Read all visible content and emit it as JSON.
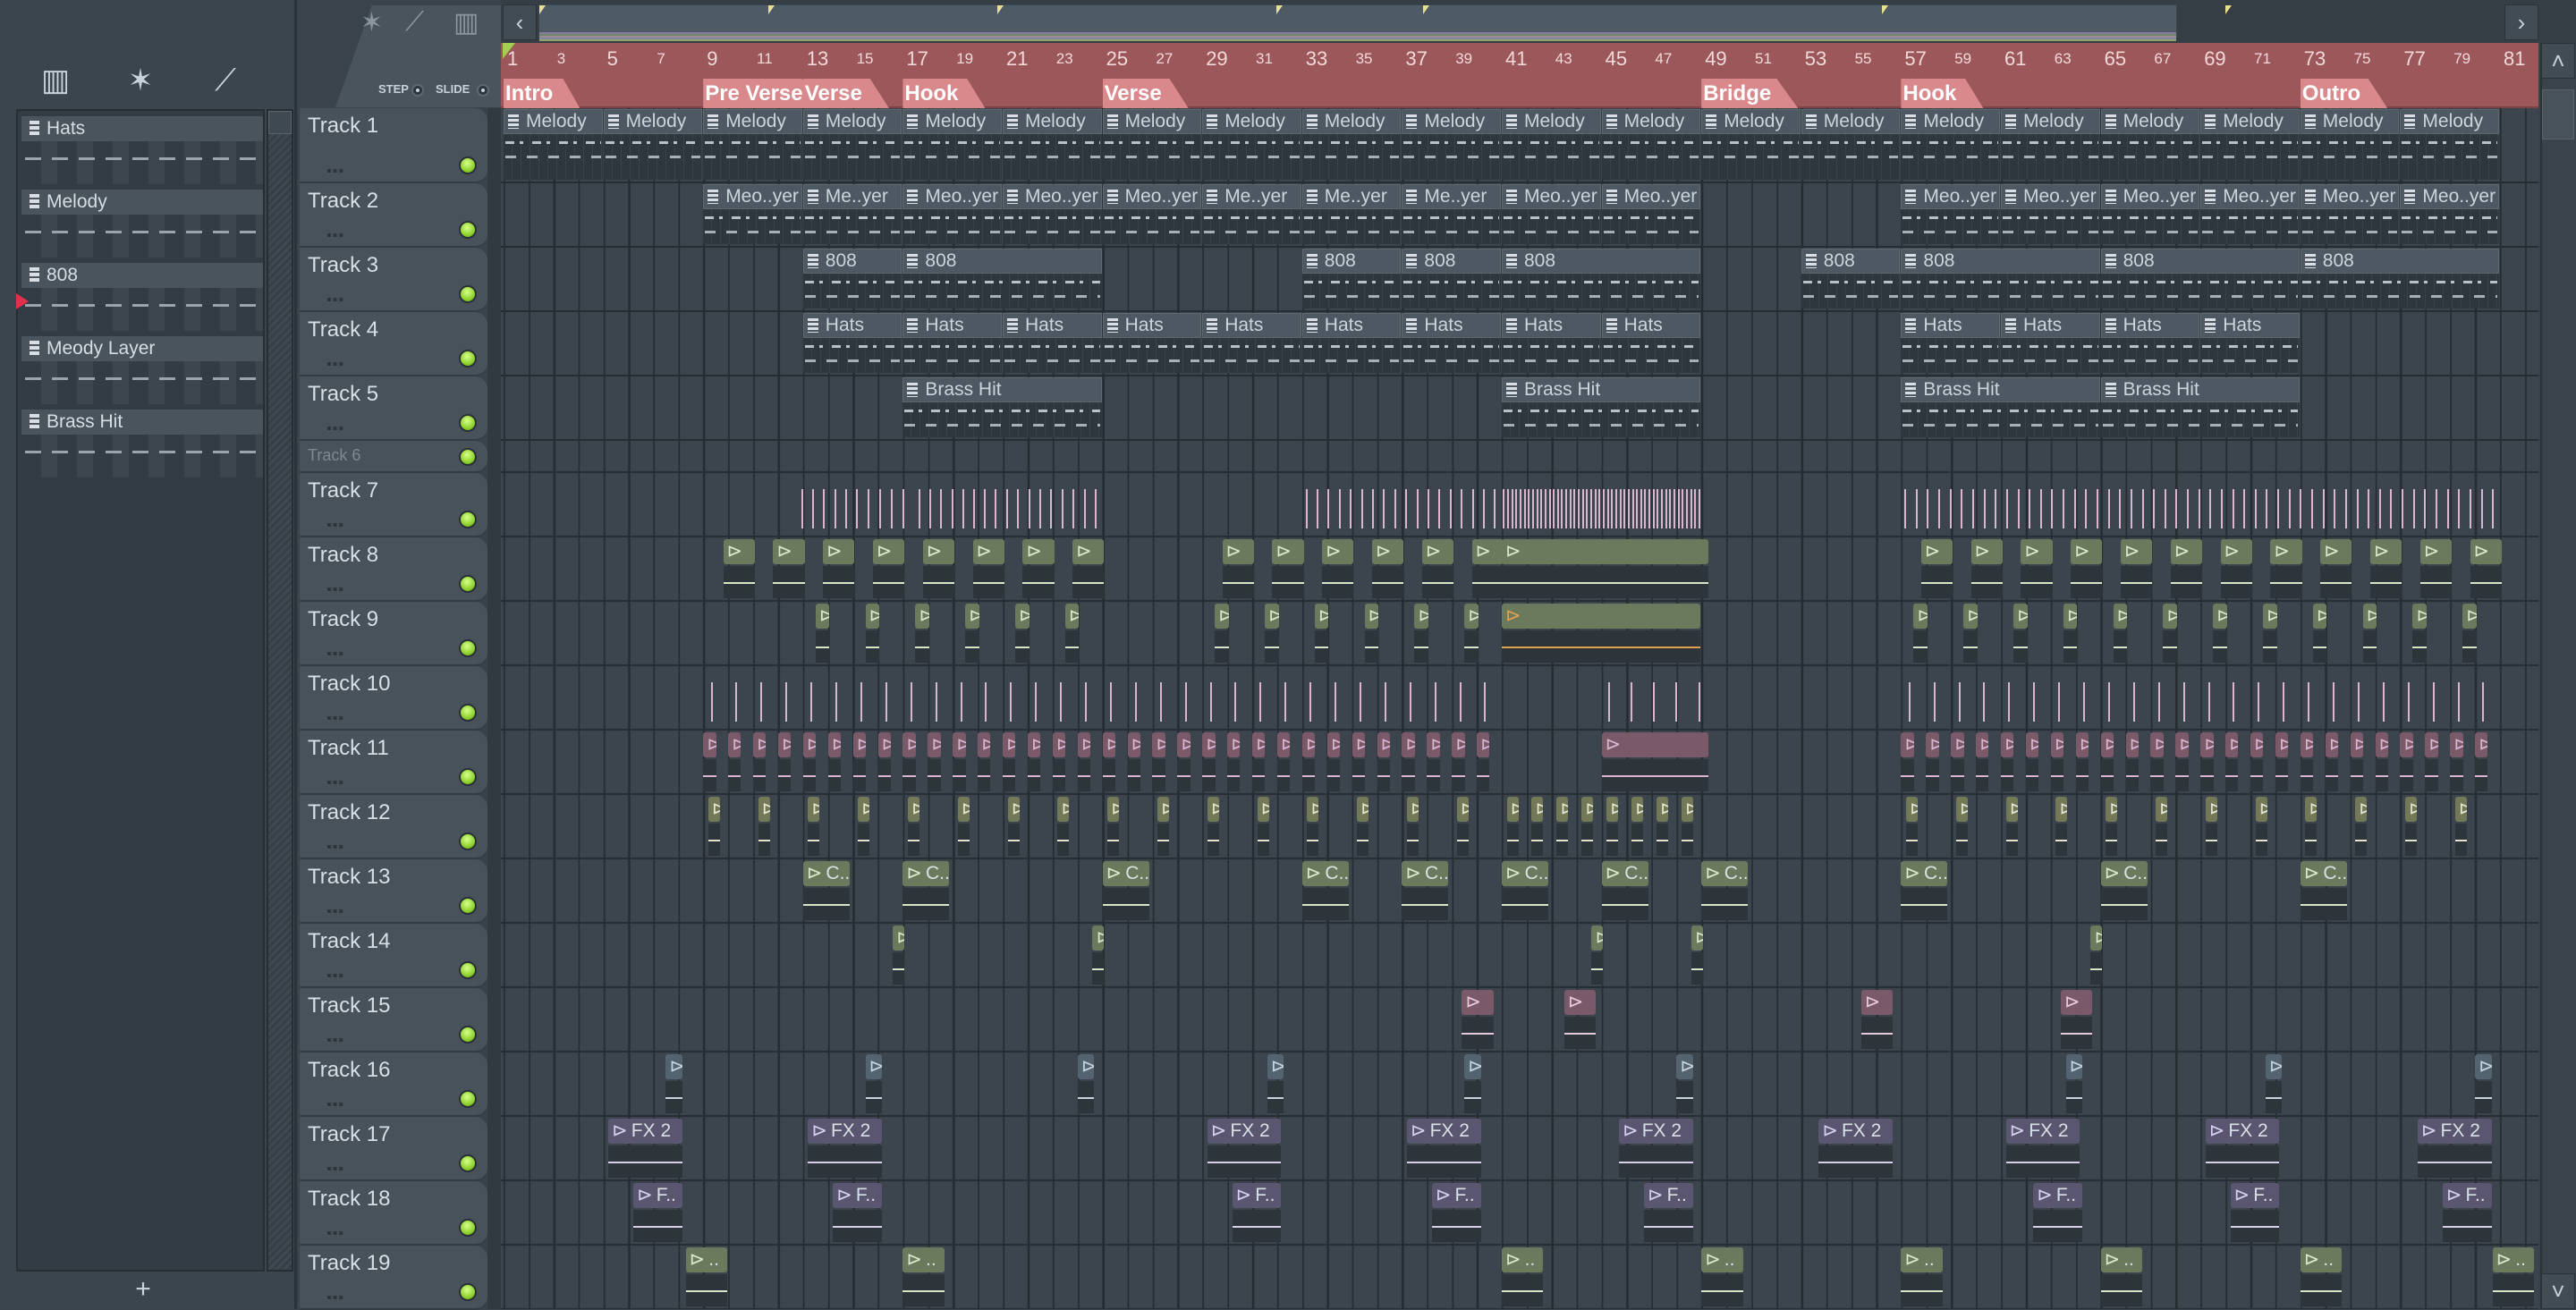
{
  "browser": {
    "tools": [
      {
        "icon": "piano-roll-icon",
        "glyph": "▥"
      },
      {
        "icon": "waveform-icon",
        "glyph": "✶"
      },
      {
        "icon": "automation-icon",
        "glyph": "⟋"
      }
    ],
    "patterns": [
      {
        "name": "Hats",
        "selected": false
      },
      {
        "name": "Melody",
        "selected": false
      },
      {
        "name": "808",
        "selected": true
      },
      {
        "name": "Meody Layer",
        "selected": false
      },
      {
        "name": "Brass Hit",
        "selected": false
      }
    ],
    "add_label": "+"
  },
  "header": {
    "step_label": "STEP",
    "slide_label": "SLIDE",
    "icons": [
      {
        "icon": "waveform-icon",
        "glyph": "✶"
      },
      {
        "icon": "automation-icon",
        "glyph": "⟋"
      },
      {
        "icon": "piano-roll-icon",
        "glyph": "▥"
      }
    ]
  },
  "nav": {
    "left": "‹",
    "right": "›",
    "up": "˄",
    "down": "˅"
  },
  "ruler": {
    "bars": [
      1,
      3,
      5,
      7,
      9,
      11,
      13,
      15,
      17,
      19,
      21,
      23,
      25,
      27,
      29,
      31,
      33,
      35,
      37,
      39,
      41,
      43,
      45,
      47,
      49,
      51,
      53,
      55,
      57,
      59,
      61,
      63,
      65,
      67,
      69,
      71,
      73,
      75,
      77,
      79,
      81
    ],
    "sections": [
      {
        "label": "Intro",
        "bar": 1
      },
      {
        "label": "Pre Verse",
        "bar": 9
      },
      {
        "label": "Verse",
        "bar": 13
      },
      {
        "label": "Hook",
        "bar": 17
      },
      {
        "label": "Verse",
        "bar": 25
      },
      {
        "label": "Bridge",
        "bar": 49
      },
      {
        "label": "Hook",
        "bar": 57
      },
      {
        "label": "Outro",
        "bar": 73
      }
    ]
  },
  "tracks": [
    "Track 1",
    "Track 2",
    "Track 3",
    "Track 4",
    "Track 5",
    "Track 6",
    "Track 7",
    "Track 8",
    "Track 9",
    "Track 10",
    "Track 11",
    "Track 12",
    "Track 13",
    "Track 14",
    "Track 15",
    "Track 16",
    "Track 17",
    "Track 18",
    "Track 19"
  ],
  "colors": {
    "ruler": "#9c575a",
    "section": "#d9898c",
    "led": "#8fd22e",
    "green_clip": "#6b7a5c",
    "pink_clip": "#7a5a68",
    "purple_clip": "#5a5670",
    "blue_clip": "#536470",
    "olive_clip": "#737857"
  },
  "pattern_clips": [
    {
      "track": 1,
      "label": "Melody",
      "starts": [
        1,
        5,
        9,
        13,
        17,
        21,
        25,
        29,
        33,
        37,
        41,
        45,
        49,
        53,
        57,
        61,
        65,
        69,
        73,
        77
      ],
      "len": 4
    },
    {
      "track": 2,
      "label": "Meo..yer",
      "starts": [
        9,
        17,
        21,
        25,
        41,
        45,
        57,
        61,
        65,
        69,
        73,
        77
      ],
      "len": 4
    },
    {
      "track": 2,
      "label": "Me..yer",
      "starts": [
        13,
        29,
        33,
        37
      ],
      "len": 4
    },
    {
      "track": 3,
      "label": "808",
      "starts": [
        13,
        33,
        37,
        53
      ],
      "len": 4
    },
    {
      "track": 3,
      "label": "808",
      "starts": [
        17,
        41,
        57,
        65,
        73
      ],
      "len": 8
    },
    {
      "track": 4,
      "label": "Hats",
      "starts": [
        13,
        17,
        21,
        25,
        29,
        33,
        37,
        41,
        45,
        57,
        61,
        65,
        69
      ],
      "len": 4
    },
    {
      "track": 5,
      "label": "Brass Hit",
      "starts": [
        17,
        41,
        57,
        65
      ],
      "len": 8
    }
  ],
  "audio_clips": [
    {
      "track": 8,
      "label": "",
      "color": "#6b7a5c",
      "wave": "#d9e6c8",
      "len": 1.3,
      "starts": [
        9.8,
        11.8,
        13.8,
        15.8,
        17.8,
        19.8,
        21.8,
        23.8,
        29.8,
        31.8,
        33.8,
        35.8,
        37.8,
        39.8,
        57.8,
        59.8,
        61.8,
        63.8,
        65.8,
        67.8,
        69.8,
        71.8,
        73.8,
        75.8,
        77.8,
        79.8
      ]
    },
    {
      "track": 8,
      "label": "",
      "color": "#6b7a5c",
      "wave": "#d9e6c8",
      "len": 8.3,
      "starts": [
        41
      ]
    },
    {
      "track": 9,
      "label": "",
      "color": "#6b7a5c",
      "wave": "#d9e6c8",
      "len": 0.6,
      "starts": [
        13.5,
        15.5,
        17.5,
        19.5,
        21.5,
        23.5,
        29.5,
        31.5,
        33.5,
        35.5,
        37.5,
        39.5,
        57.5,
        59.5,
        61.5,
        63.5,
        65.5,
        67.5,
        69.5,
        71.5,
        73.5,
        75.5,
        77.5,
        79.5
      ]
    },
    {
      "track": 9,
      "label": "",
      "color": "#6b7a5c",
      "wave": "#e0a050",
      "len": 8,
      "starts": [
        41
      ]
    },
    {
      "track": 11,
      "label": "",
      "color": "#7a5a68",
      "wave": "#d8b6d0",
      "len": 0.55,
      "starts": [
        9,
        10,
        11,
        12,
        13,
        14,
        15,
        16,
        17,
        18,
        19,
        20,
        21,
        22,
        23,
        24,
        25,
        26,
        27,
        28,
        29,
        30,
        31,
        32,
        33,
        34,
        35,
        36,
        37,
        38,
        39,
        40,
        57,
        58,
        59,
        60,
        61,
        62,
        63,
        64,
        65,
        66,
        67,
        68,
        69,
        70,
        71,
        72,
        73,
        74,
        75,
        76,
        77,
        78,
        79,
        80
      ]
    },
    {
      "track": 11,
      "label": "",
      "color": "#7a5a68",
      "wave": "#d8b6d0",
      "len": 4.3,
      "starts": [
        45
      ]
    },
    {
      "track": 12,
      "label": "",
      "color": "#737857",
      "wave": "#e2e6cf",
      "len": 0.5,
      "starts": [
        9.2,
        11.2,
        13.2,
        15.2,
        17.2,
        19.2,
        21.2,
        23.2,
        25.2,
        27.2,
        29.2,
        31.2,
        33.2,
        35.2,
        37.2,
        39.2,
        41.2,
        42.2,
        43.2,
        44.2,
        45.2,
        46.2,
        47.2,
        48.2,
        57.2,
        59.2,
        61.2,
        63.2,
        65.2,
        67.2,
        69.2,
        71.2,
        73.2,
        75.2,
        77.2,
        79.2
      ]
    },
    {
      "track": 13,
      "label": "C..",
      "color": "#6b7a5c",
      "wave": "#d9e6c8",
      "len": 1.9,
      "starts": [
        13,
        17,
        25,
        33,
        37,
        41,
        45,
        49,
        57,
        65,
        73
      ]
    },
    {
      "track": 14,
      "label": "",
      "color": "#6b7a5c",
      "wave": "#d9e6c8",
      "len": 0.5,
      "starts": [
        16.6,
        24.6,
        44.6,
        48.6,
        64.6
      ]
    },
    {
      "track": 15,
      "label": "",
      "color": "#7a5a68",
      "wave": "#e8c8dc",
      "len": 1.3,
      "starts": [
        39.4,
        43.5,
        55.4,
        63.4
      ]
    },
    {
      "track": 16,
      "label": "",
      "color": "#536470",
      "wave": "#c8d3dc",
      "len": 0.7,
      "starts": [
        7.5,
        15.5,
        24,
        31.6,
        39.5,
        48,
        63.6,
        71.6,
        80
      ]
    },
    {
      "track": 17,
      "label": "FX 2",
      "color": "#5a5670",
      "wave": "#d6d0ea",
      "len": 3,
      "starts": [
        5.2,
        13.2,
        29.2,
        37.2,
        45.7,
        53.7,
        61.2,
        69.2,
        77.7
      ]
    },
    {
      "track": 18,
      "label": "F..",
      "color": "#5a5670",
      "wave": "#d6d0ea",
      "len": 2,
      "starts": [
        6.2,
        14.2,
        30.2,
        38.2,
        46.7,
        62.3,
        70.2,
        78.7
      ]
    },
    {
      "track": 19,
      "label": "..",
      "color": "#6b7a5c",
      "wave": "#d9e6c8",
      "len": 1.7,
      "starts": [
        8.3,
        17,
        41,
        49,
        57,
        65,
        73,
        80.7
      ]
    }
  ],
  "tick_clips": [
    {
      "track": 7,
      "ranges": [
        [
          12.8,
          15
        ],
        [
          15,
          17.3
        ],
        [
          17.5,
          21
        ],
        [
          21,
          25
        ],
        [
          33,
          37
        ],
        [
          37,
          41
        ],
        [
          57,
          81
        ]
      ],
      "density": 2.2
    },
    {
      "track": 7,
      "ranges": [
        [
          41,
          49
        ]
      ],
      "density": 6
    },
    {
      "track": 10,
      "ranges": [
        [
          9,
          41
        ],
        [
          45,
          49.5
        ],
        [
          57,
          81
        ]
      ],
      "density": 1
    }
  ]
}
